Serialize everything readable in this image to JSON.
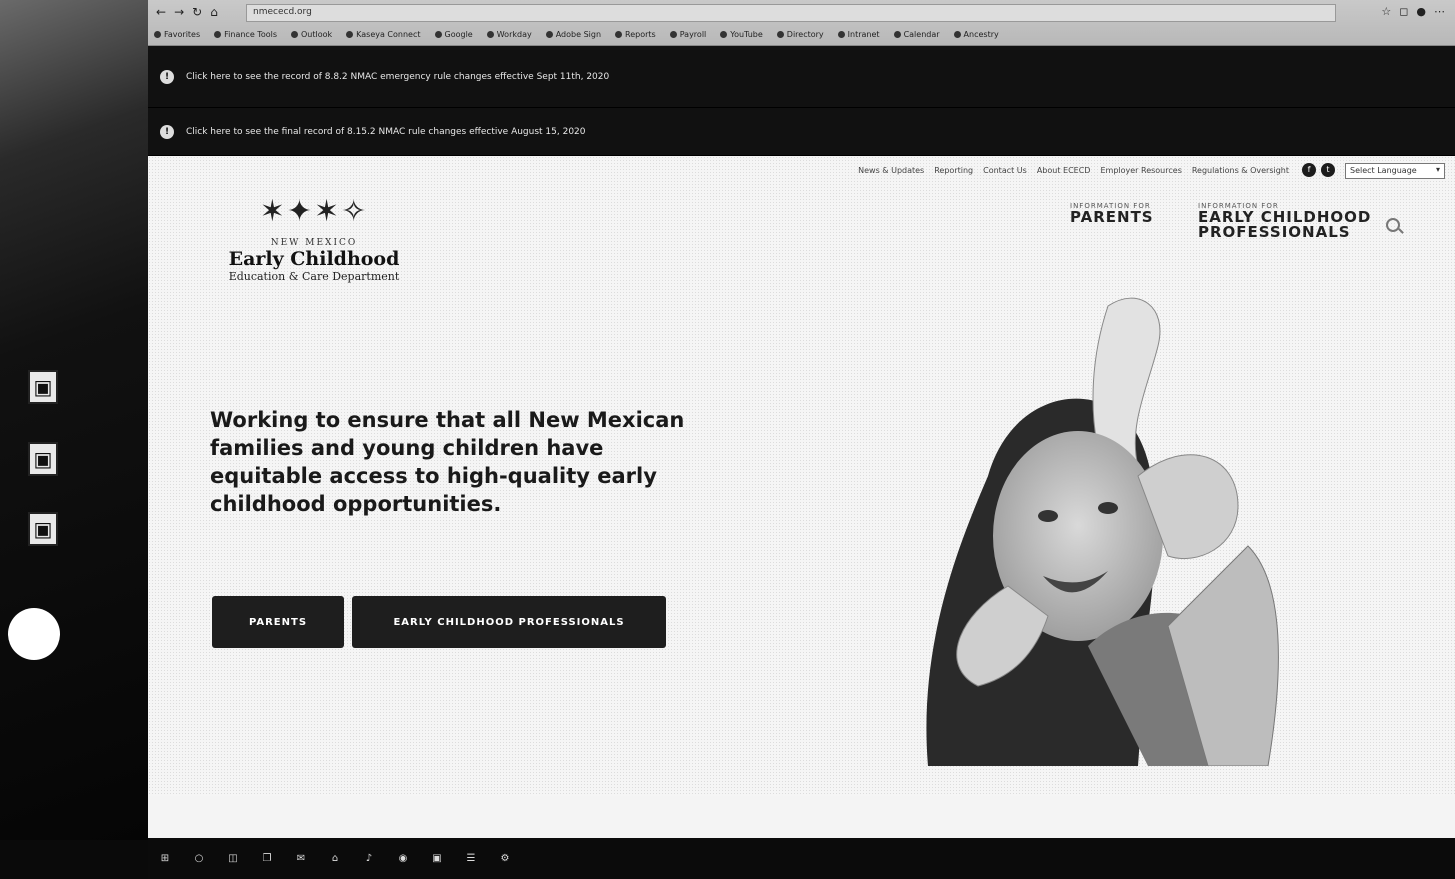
{
  "browser": {
    "address": "nmececd.org",
    "nav_glyphs": [
      "←",
      "→",
      "↻",
      "⌂"
    ],
    "menu_glyphs": [
      "☆",
      "◻",
      "●",
      "⋯"
    ],
    "bookmarks": [
      "Favorites",
      "Finance Tools",
      "Outlook",
      "Kaseya Connect",
      "Google",
      "Workday",
      "Adobe Sign",
      "Reports",
      "Payroll",
      "YouTube",
      "Directory",
      "Intranet",
      "Calendar",
      "Ancestry"
    ]
  },
  "alerts": [
    {
      "icon": "!",
      "text": "Click here to see the record of 8.8.2 NMAC emergency rule changes effective Sept 11th, 2020"
    },
    {
      "icon": "!",
      "text": "Click here to see the final record of 8.15.2 NMAC rule changes effective August 15, 2020"
    }
  ],
  "site": {
    "utility_nav": [
      "News & Updates",
      "Reporting",
      "Contact Us",
      "About ECECD",
      "Employer Resources",
      "Regulations & Oversight"
    ],
    "social": [
      "f",
      "t"
    ],
    "translate_label": "Select Language",
    "logo": {
      "figures": "✶✦✶✧",
      "small": "NEW MEXICO",
      "main": "Early Childhood",
      "sub": "Education & Care Department"
    },
    "audiences": [
      {
        "kicker": "INFORMATION FOR",
        "title": "PARENTS"
      },
      {
        "kicker": "INFORMATION FOR",
        "title": "EARLY CHILDHOOD PROFESSIONALS"
      }
    ],
    "headline": "Working to ensure that all New Mexican families and young children have equitable access to high-quality early childhood opportunities.",
    "buttons": {
      "parents": "PARENTS",
      "professionals": "EARLY CHILDHOOD PROFESSIONALS"
    }
  },
  "taskbar": [
    "⊞",
    "○",
    "◫",
    "❐",
    "✉",
    "⌂",
    "♪",
    "◉",
    "▣",
    "☰",
    "⚙"
  ]
}
